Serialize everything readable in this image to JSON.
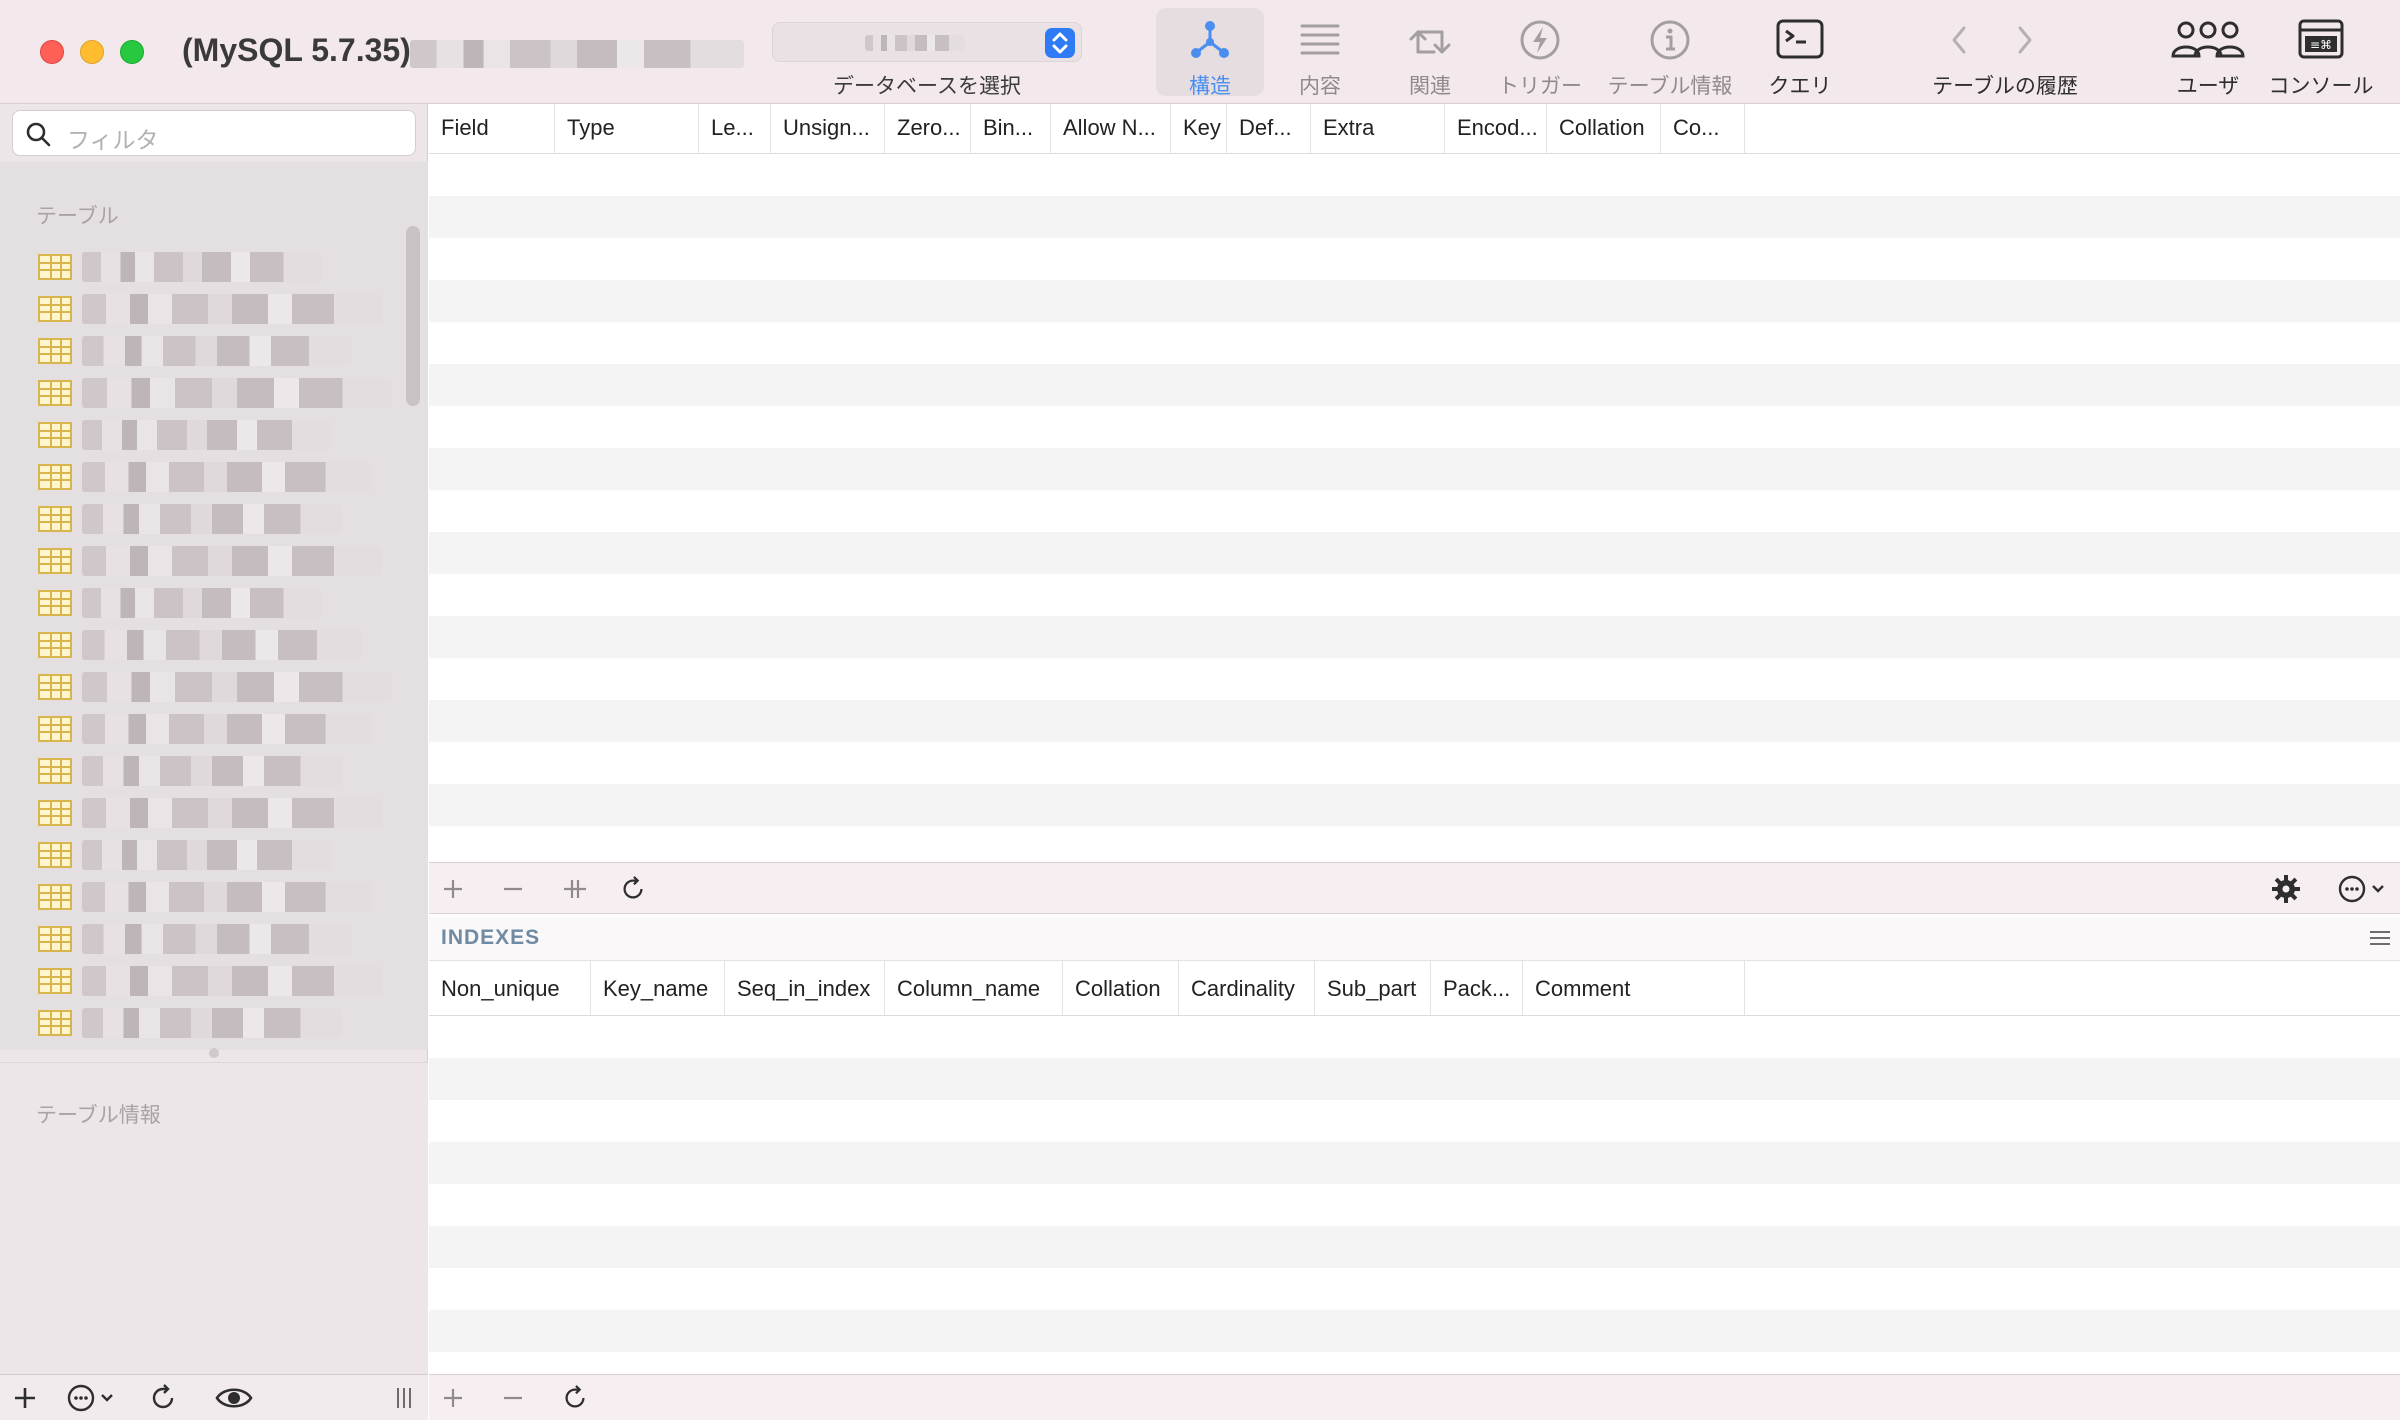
{
  "window": {
    "title": "(MySQL 5.7.35)"
  },
  "toolbar": {
    "db_select_label": "データベースを選択",
    "items": [
      {
        "label": "構造",
        "icon": "structure-icon",
        "state": "active"
      },
      {
        "label": "内容",
        "icon": "content-icon",
        "state": "disabled"
      },
      {
        "label": "関連",
        "icon": "relations-icon",
        "state": "disabled"
      },
      {
        "label": "トリガー",
        "icon": "trigger-icon",
        "state": "disabled"
      },
      {
        "label": "テーブル情報",
        "icon": "info-icon",
        "state": "disabled"
      },
      {
        "label": "クエリ",
        "icon": "query-icon",
        "state": "enabled"
      }
    ],
    "history_label": "テーブルの履歴",
    "users_label": "ユーザ",
    "console_label": "コンソール",
    "accent_color": "#4a8ef0"
  },
  "sidebar": {
    "filter_placeholder": "フィルタ",
    "tables_heading": "テーブル",
    "table_info_heading": "テーブル情報"
  },
  "structure": {
    "columns": [
      "Field",
      "Type",
      "Le...",
      "Unsign...",
      "Zero...",
      "Bin...",
      "Allow N...",
      "Key",
      "Def...",
      "Extra",
      "Encod...",
      "Collation",
      "Co..."
    ]
  },
  "indexes": {
    "title": "INDEXES",
    "columns": [
      "Non_unique",
      "Key_name",
      "Seq_in_index",
      "Column_name",
      "Collation",
      "Cardinality",
      "Sub_part",
      "Pack...",
      "Comment"
    ]
  }
}
